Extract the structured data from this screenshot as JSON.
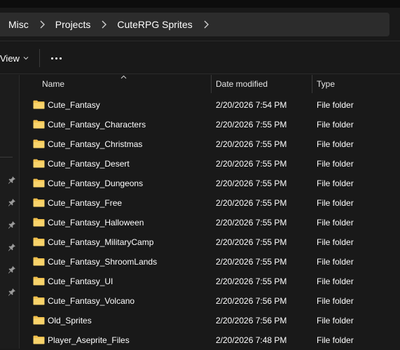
{
  "breadcrumb": [
    "Misc",
    "Projects",
    "CuteRPG Sprites"
  ],
  "toolbar": {
    "view_label": "View"
  },
  "columns": {
    "name": "Name",
    "date": "Date modified",
    "type": "Type"
  },
  "colors": {
    "background": "#191919",
    "addressbar": "#2c2c2c",
    "folder": "#f2c14e"
  },
  "rows": [
    {
      "name": "Cute_Fantasy",
      "date": "2/20/2026 7:54 PM",
      "type": "File folder"
    },
    {
      "name": "Cute_Fantasy_Characters",
      "date": "2/20/2026 7:55 PM",
      "type": "File folder"
    },
    {
      "name": "Cute_Fantasy_Christmas",
      "date": "2/20/2026 7:55 PM",
      "type": "File folder"
    },
    {
      "name": "Cute_Fantasy_Desert",
      "date": "2/20/2026 7:55 PM",
      "type": "File folder"
    },
    {
      "name": "Cute_Fantasy_Dungeons",
      "date": "2/20/2026 7:55 PM",
      "type": "File folder"
    },
    {
      "name": "Cute_Fantasy_Free",
      "date": "2/20/2026 7:55 PM",
      "type": "File folder"
    },
    {
      "name": "Cute_Fantasy_Halloween",
      "date": "2/20/2026 7:55 PM",
      "type": "File folder"
    },
    {
      "name": "Cute_Fantasy_MilitaryCamp",
      "date": "2/20/2026 7:55 PM",
      "type": "File folder"
    },
    {
      "name": "Cute_Fantasy_ShroomLands",
      "date": "2/20/2026 7:55 PM",
      "type": "File folder"
    },
    {
      "name": "Cute_Fantasy_UI",
      "date": "2/20/2026 7:55 PM",
      "type": "File folder"
    },
    {
      "name": "Cute_Fantasy_Volcano",
      "date": "2/20/2026 7:56 PM",
      "type": "File folder"
    },
    {
      "name": "Old_Sprites",
      "date": "2/20/2026 7:56 PM",
      "type": "File folder"
    },
    {
      "name": "Player_Aseprite_Files",
      "date": "2/20/2026 7:48 PM",
      "type": "File folder"
    }
  ]
}
